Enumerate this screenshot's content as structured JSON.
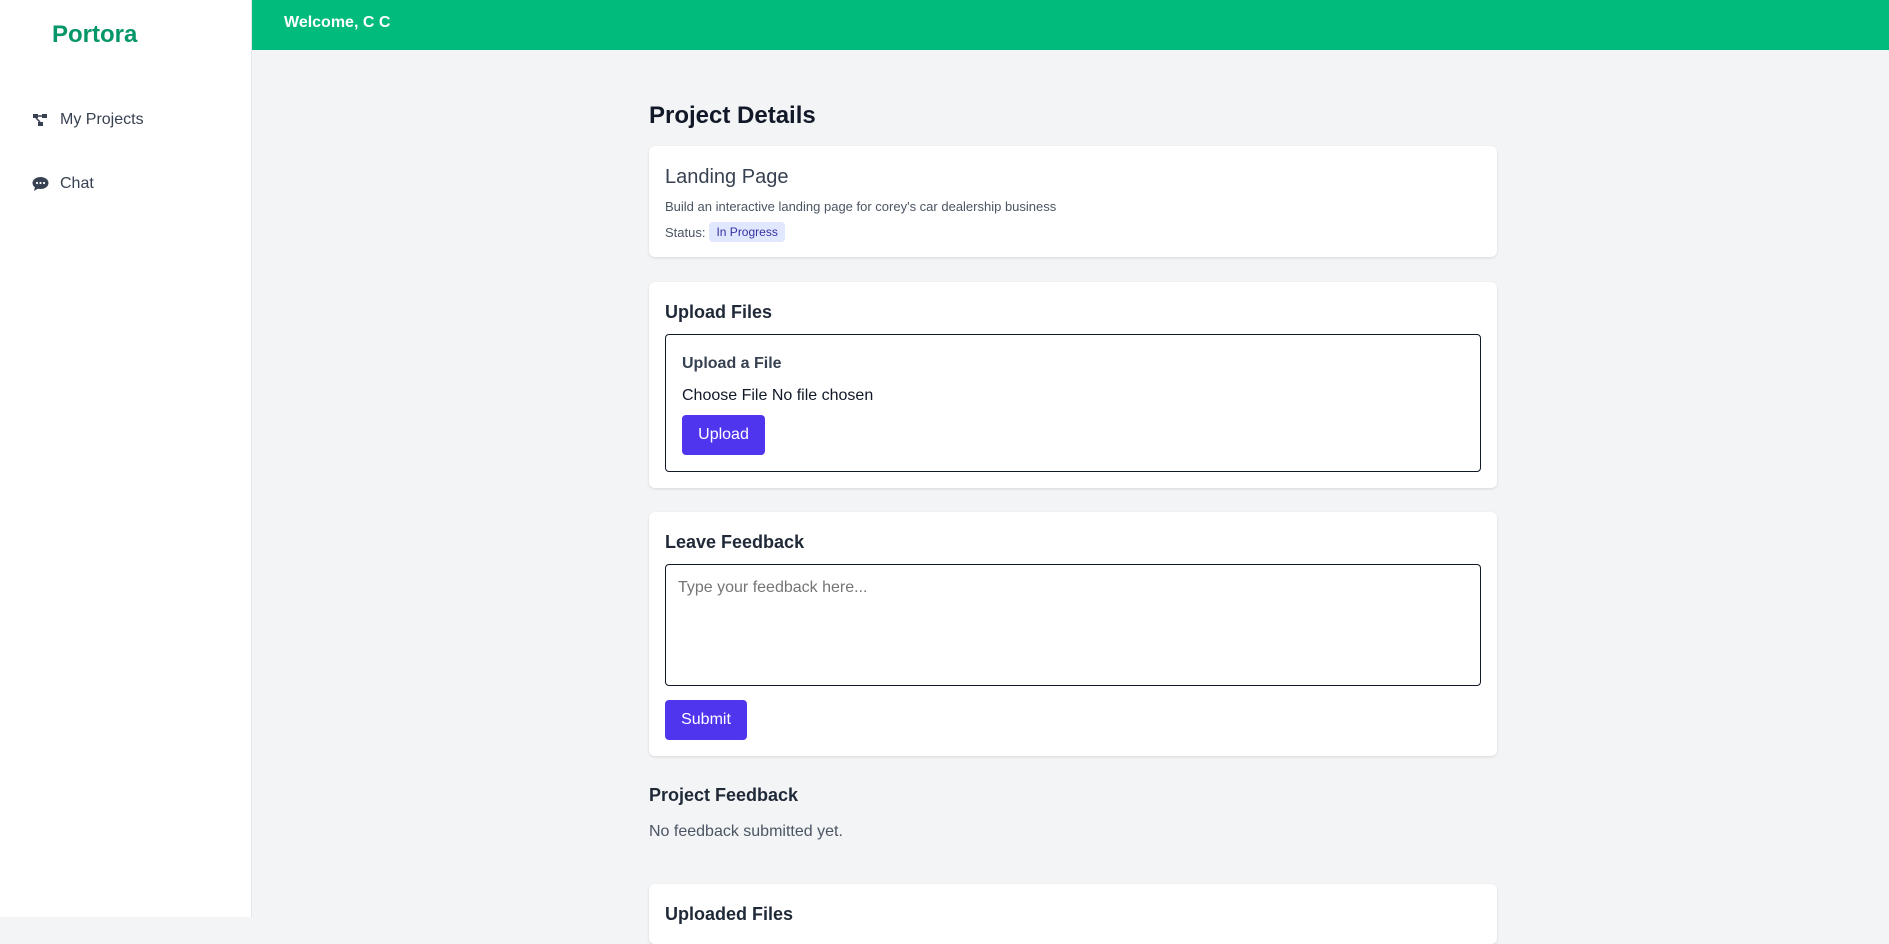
{
  "app": {
    "brand": "Portora",
    "welcome": "Welcome, C C"
  },
  "sidebar": {
    "items": [
      {
        "label": "My Projects",
        "icon": "projects-icon"
      },
      {
        "label": "Chat",
        "icon": "chat-icon"
      }
    ]
  },
  "page": {
    "title": "Project Details"
  },
  "project": {
    "name": "Landing Page",
    "description": "Build an interactive landing page for corey's car dealership business",
    "status_label": "Status:",
    "status": "In Progress"
  },
  "upload": {
    "heading": "Upload Files",
    "box_heading": "Upload a File",
    "choose_label": "Choose File",
    "file_state": "No file chosen",
    "button": "Upload"
  },
  "feedback": {
    "heading": "Leave Feedback",
    "placeholder": "Type your feedback here...",
    "button": "Submit"
  },
  "project_feedback": {
    "heading": "Project Feedback",
    "empty": "No feedback submitted yet."
  },
  "uploaded_files": {
    "heading": "Uploaded Files"
  },
  "colors": {
    "accent": "#00bb7c",
    "brand": "#059669",
    "button": "#4f35ee",
    "badge_bg": "#e0e7ff",
    "badge_text": "#3730a3"
  }
}
